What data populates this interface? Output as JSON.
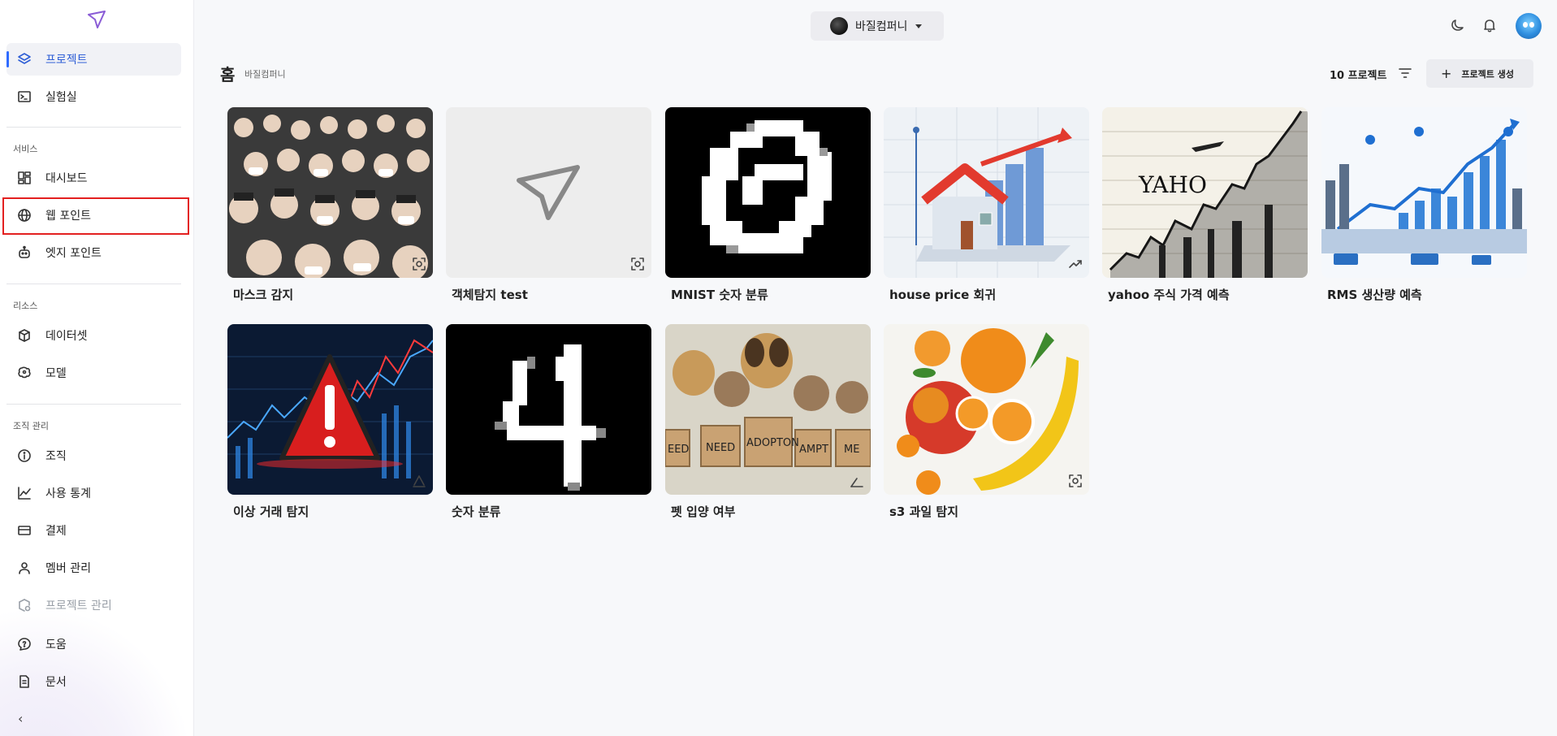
{
  "sidebar": {
    "items_top": [
      {
        "label": "프로젝트",
        "icon": "layers-icon"
      },
      {
        "label": "실험실",
        "icon": "terminal-icon"
      }
    ],
    "section_service": "서비스",
    "items_service": [
      {
        "label": "대시보드",
        "icon": "dashboard-icon"
      },
      {
        "label": "웹 포인트",
        "icon": "globe-icon"
      },
      {
        "label": "엣지 포인트",
        "icon": "robot-icon"
      }
    ],
    "section_resource": "리소스",
    "items_resource": [
      {
        "label": "데이터셋",
        "icon": "cube-icon"
      },
      {
        "label": "모델",
        "icon": "brain-icon"
      }
    ],
    "section_org": "조직 관리",
    "items_org": [
      {
        "label": "조직",
        "icon": "info-icon"
      },
      {
        "label": "사용 통계",
        "icon": "chart-line-icon"
      },
      {
        "label": "결제",
        "icon": "credit-card-icon"
      },
      {
        "label": "멤버 관리",
        "icon": "user-icon"
      },
      {
        "label": "프로젝트 관리",
        "icon": "project-settings-icon"
      }
    ],
    "items_bottom": [
      {
        "label": "도움",
        "icon": "help-icon"
      },
      {
        "label": "문서",
        "icon": "document-icon"
      }
    ],
    "collapse": "‹"
  },
  "topbar": {
    "org_name": "바질컴퍼니",
    "icons": [
      "moon-icon",
      "bell-icon"
    ]
  },
  "header": {
    "title": "홈",
    "subtitle": "바질컴퍼니",
    "count": "10 프로젝트",
    "create_label": "프로젝트 생성"
  },
  "projects": [
    {
      "title": "마스크 감지",
      "badge": "object-detection-icon"
    },
    {
      "title": "객체탐지 test",
      "badge": "object-detection-icon"
    },
    {
      "title": "MNIST 숫자 분류",
      "badge": ""
    },
    {
      "title": "house price 회귀",
      "badge": "trend-icon"
    },
    {
      "title": "yahoo 주식 가격 예측",
      "badge": ""
    },
    {
      "title": "RMS 생산량 예측",
      "badge": ""
    },
    {
      "title": "이상 거래 탐지",
      "badge": "anomaly-icon"
    },
    {
      "title": "숫자 분류",
      "badge": ""
    },
    {
      "title": "펫 입양 여부",
      "badge": "tabular-icon"
    },
    {
      "title": "s3 과일 탐지",
      "badge": "object-detection-icon"
    }
  ],
  "art_text": {
    "yahoo": "YAHO",
    "pet_signs": [
      "EED",
      "NEED",
      "ADOPTON",
      "AMPT",
      "ME"
    ]
  },
  "colors": {
    "accent": "#2f5fd6",
    "highlight": "#e32020",
    "sidebar_bg": "#ffffff",
    "page_bg": "#f7f8fa"
  }
}
